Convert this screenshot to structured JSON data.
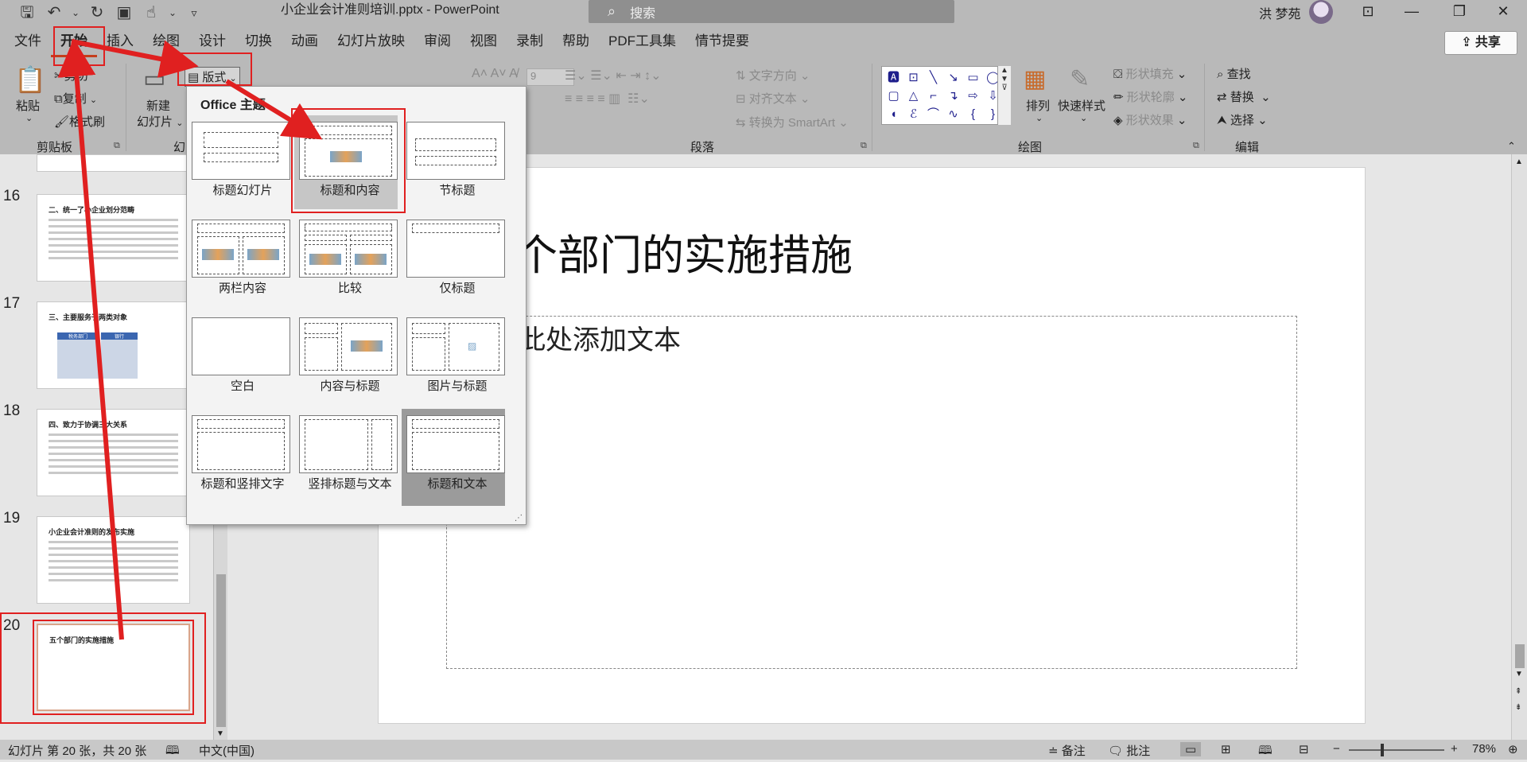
{
  "titlebar": {
    "doc_title": "小企业会计准则培训.pptx  -  PowerPoint",
    "search_placeholder": "搜索",
    "user_name": "洪 梦苑"
  },
  "menu": {
    "tabs": [
      "文件",
      "开始",
      "插入",
      "绘图",
      "设计",
      "切换",
      "动画",
      "幻灯片放映",
      "审阅",
      "视图",
      "录制",
      "帮助",
      "PDF工具集",
      "情节提要"
    ],
    "share_label": "共享"
  },
  "ribbon": {
    "clipboard": {
      "paste": "粘贴",
      "cut": "剪切",
      "copy": "复制",
      "format_painter": "格式刷",
      "group": "剪贴板"
    },
    "slides": {
      "new_slide_line1": "新建",
      "new_slide_line2": "幻灯片",
      "layout": "版式",
      "group_partial": "幻"
    },
    "paragraph": {
      "text_direction": "文字方向",
      "align_text": "对齐文本",
      "smartart": "转换为 SmartArt",
      "group": "段落"
    },
    "drawing": {
      "arrange": "排列",
      "quick_styles": "快速样式",
      "shape_fill": "形状填充",
      "shape_outline": "形状轮廓",
      "shape_effects": "形状效果",
      "group": "绘图"
    },
    "editing": {
      "find": "查找",
      "replace": "替换",
      "select": "选择",
      "group": "编辑"
    },
    "font_size_value": "9"
  },
  "layout_menu": {
    "header": "Office 主题",
    "items": [
      "标题幻灯片",
      "标题和内容",
      "节标题",
      "两栏内容",
      "比较",
      "仅标题",
      "空白",
      "内容与标题",
      "图片与标题",
      "标题和竖排文字",
      "竖排标题与文本",
      "标题和文本"
    ]
  },
  "slides_panel": [
    {
      "num": "16",
      "title": "二、统一了小企业划分范畴"
    },
    {
      "num": "17",
      "title": "三、主要服务于两类对象",
      "table_head_1": "税务部门",
      "table_head_2": "银行"
    },
    {
      "num": "18",
      "title": "四、致力于协调三大关系"
    },
    {
      "num": "19",
      "title": "小企业会计准则的发布实施"
    },
    {
      "num": "20",
      "title": "五个部门的实施措施"
    }
  ],
  "slide": {
    "title": "个部门的实施措施",
    "content_placeholder": "此处添加文本"
  },
  "status": {
    "slide_info": "幻灯片 第 20 张，共 20 张",
    "language": "中文(中国)",
    "notes": "备注",
    "comments": "批注",
    "zoom": "78%"
  }
}
